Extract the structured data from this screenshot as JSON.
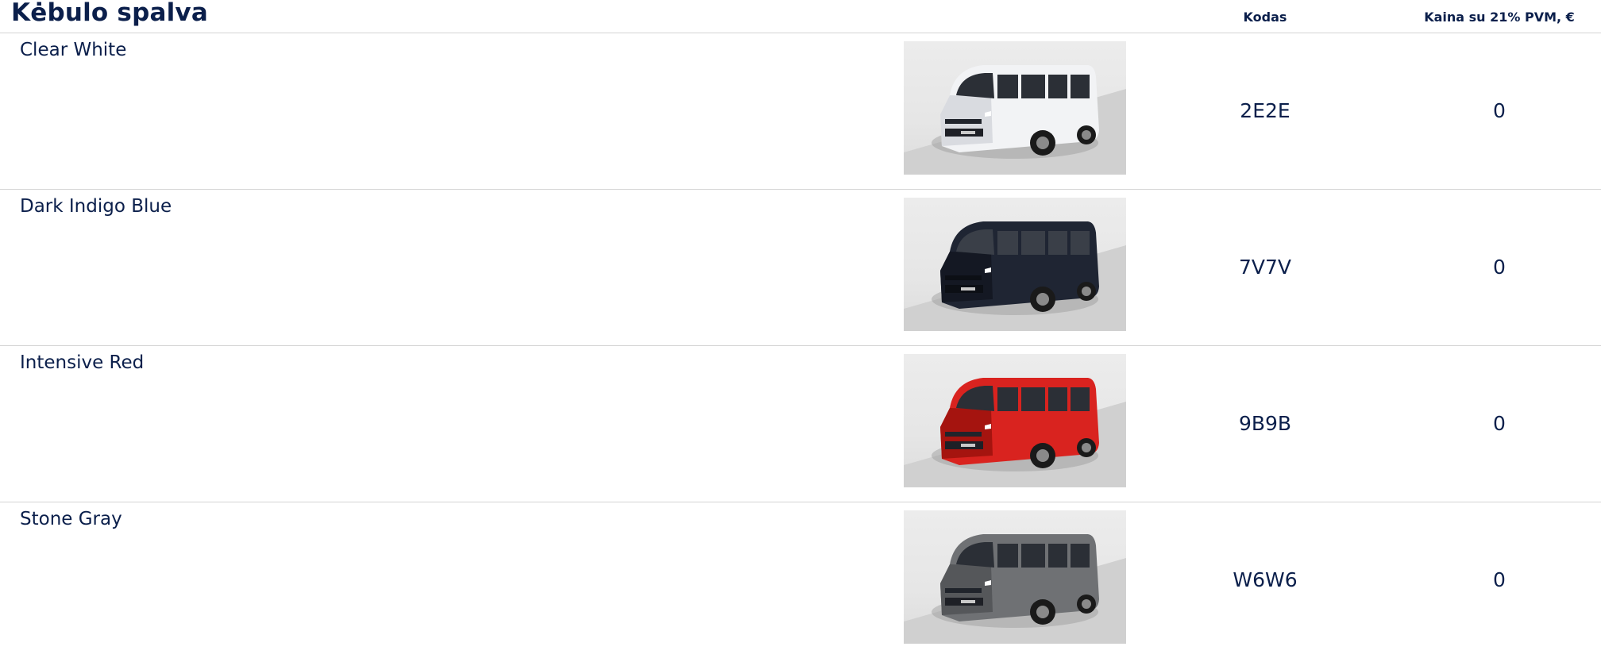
{
  "header": {
    "title": "Kėbulo spalva",
    "code_label": "Kodas",
    "price_label": "Kaina su 21% PVM, €"
  },
  "rows": [
    {
      "name": "Clear White",
      "code": "2E2E",
      "price": "0",
      "body_color": "#f2f3f5",
      "shade_color": "#d9dbe0"
    },
    {
      "name": "Dark Indigo Blue",
      "code": "7V7V",
      "price": "0",
      "body_color": "#1f2533",
      "shade_color": "#141823"
    },
    {
      "name": "Intensive Red",
      "code": "9B9B",
      "price": "0",
      "body_color": "#d9231f",
      "shade_color": "#a5140f"
    },
    {
      "name": "Stone Gray",
      "code": "W6W6",
      "price": "0",
      "body_color": "#6f7174",
      "shade_color": "#55575a"
    }
  ]
}
